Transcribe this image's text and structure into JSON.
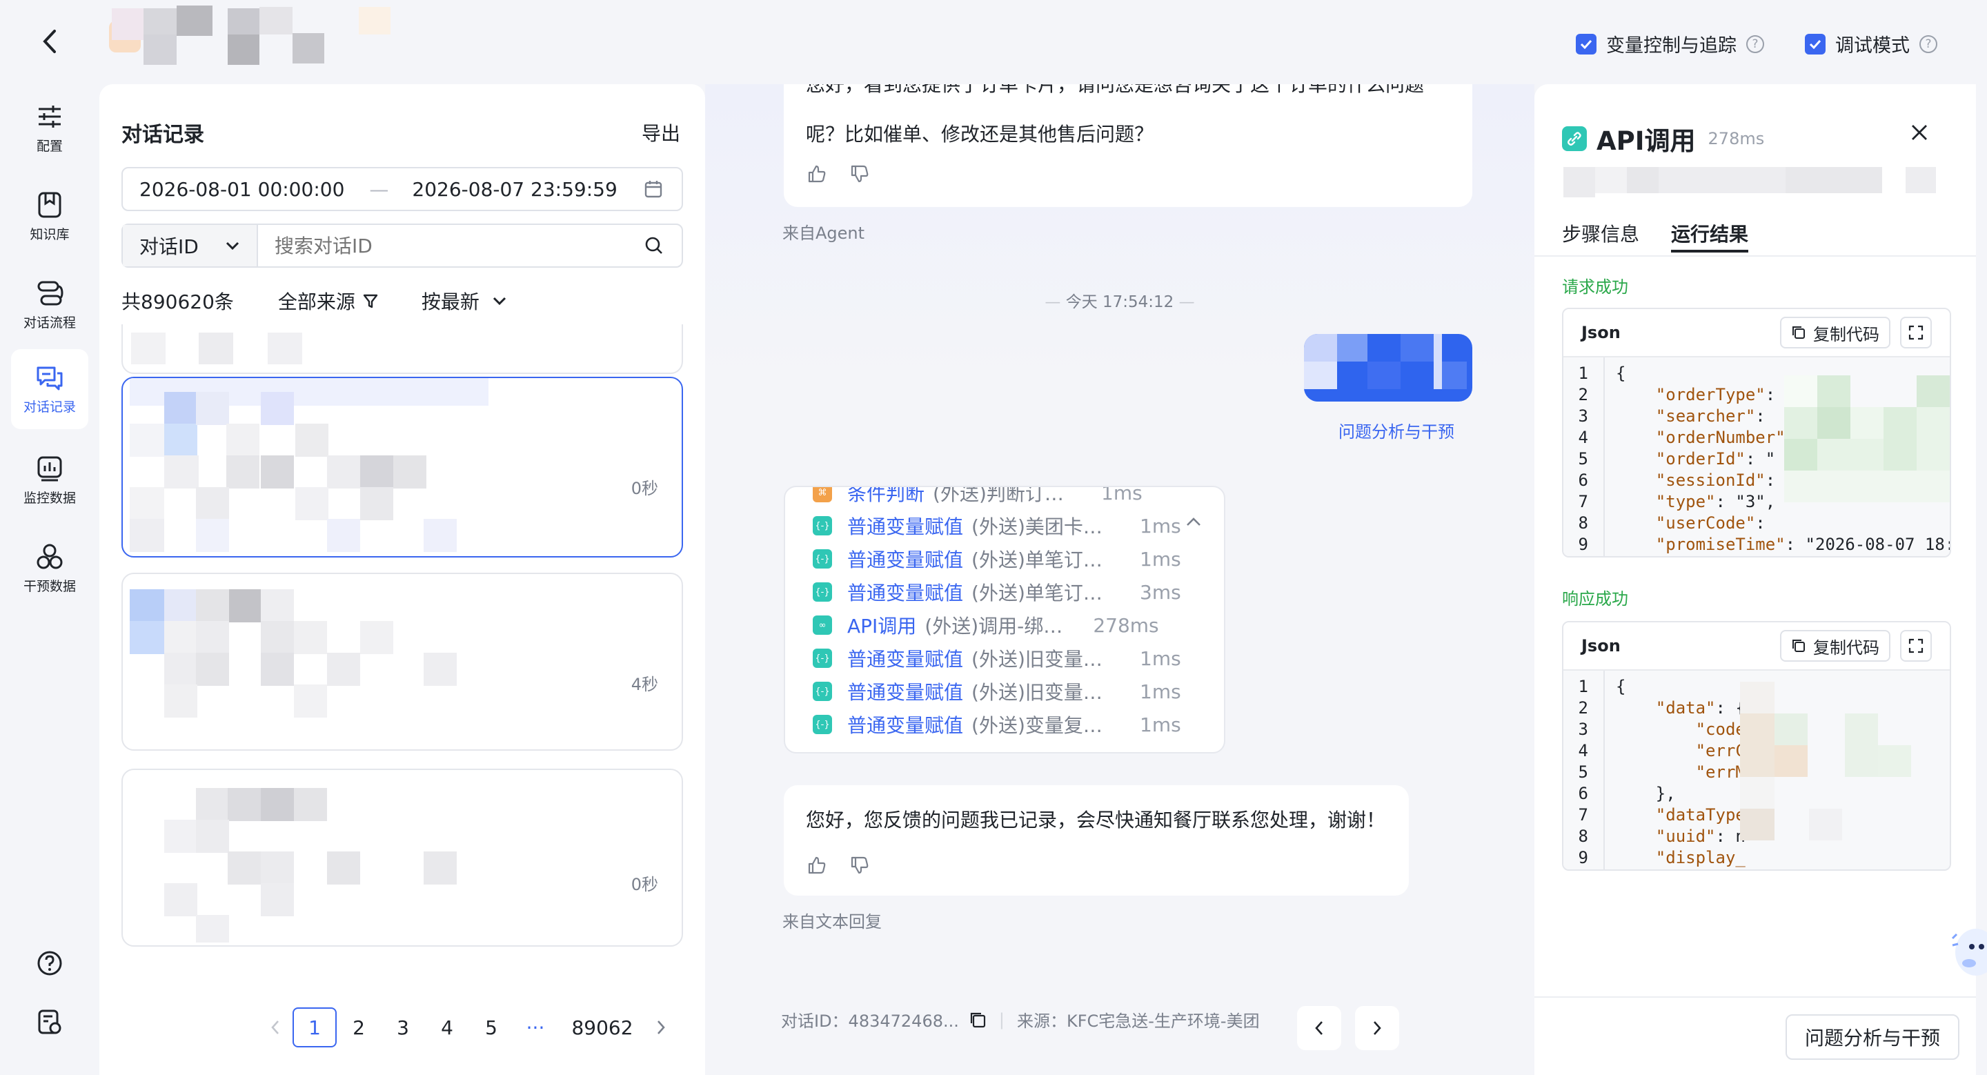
{
  "topbar": {
    "var_control_label": "变量控制与追踪",
    "debug_mode_label": "调试模式"
  },
  "sidebar": {
    "items": [
      {
        "label": "配置",
        "icon": "sliders-icon"
      },
      {
        "label": "知识库",
        "icon": "bookmark-icon"
      },
      {
        "label": "对话流程",
        "icon": "flow-icon"
      },
      {
        "label": "对话记录",
        "icon": "chat-icon"
      },
      {
        "label": "监控数据",
        "icon": "chart-icon"
      },
      {
        "label": "干预数据",
        "icon": "shapes-icon"
      }
    ]
  },
  "conversation_panel": {
    "title": "对话记录",
    "export_label": "导出",
    "date_start": "2026-08-01 00:00:00",
    "date_end": "2026-08-07 23:59:59",
    "date_separator": "—",
    "search_type": "对话ID",
    "search_placeholder": "搜索对话ID",
    "total_label": "共890620条",
    "source_filter": "全部来源",
    "sort_label": "按最新",
    "cards": [
      {
        "duration": "0秒"
      },
      {
        "duration": "4秒"
      },
      {
        "duration": "0秒"
      }
    ],
    "pagination": {
      "pages": [
        "1",
        "2",
        "3",
        "4",
        "5"
      ],
      "ellipsis": "···",
      "last": "89062",
      "current": "1"
    }
  },
  "chat": {
    "msg1_partial_line": "您好，看到您提供了订单卡片，请问您是想咨询关于这个订单的什么问题",
    "msg1_text": "呢？比如催单、修改还是其他售后问题？",
    "msg1_source": "来自Agent",
    "timestamp": "今天 17:54:12",
    "user_action_link": "问题分析与干预",
    "steps": [
      {
        "name": "条件判断",
        "desc": "(外送)判断订单卡片...",
        "ms": "1ms",
        "kind": "condition"
      },
      {
        "name": "普通变量赋值",
        "desc": "(外送)美团卡片...",
        "ms": "1ms",
        "kind": "var"
      },
      {
        "name": "普通变量赋值",
        "desc": "(外送)单笔订单...",
        "ms": "1ms",
        "kind": "var"
      },
      {
        "name": "普通变量赋值",
        "desc": "(外送)单笔订单...",
        "ms": "3ms",
        "kind": "var"
      },
      {
        "name": "API调用",
        "desc": "(外送)调用-绑定订...",
        "ms": "278ms",
        "kind": "api"
      },
      {
        "name": "普通变量赋值",
        "desc": "(外送)旧变量赋...",
        "ms": "1ms",
        "kind": "var"
      },
      {
        "name": "普通变量赋值",
        "desc": "(外送)旧变量赋...",
        "ms": "1ms",
        "kind": "var"
      },
      {
        "name": "普通变量赋值",
        "desc": "(外送)变量复制...",
        "ms": "1ms",
        "kind": "var"
      }
    ],
    "msg2_text": "您好，您反馈的问题我已记录，会尽快通知餐厅联系您处理，谢谢！",
    "msg2_source": "来自文本回复",
    "footer_conv_id": "对话ID：483472468...",
    "footer_source": "来源：KFC宅急送-生产环境-美团"
  },
  "right_panel": {
    "title": "API调用",
    "duration": "278ms",
    "tabs": [
      "步骤信息",
      "运行结果"
    ],
    "active_tab": "运行结果",
    "request_status": "请求成功",
    "response_status": "响应成功",
    "code_lang": "Json",
    "copy_label": "复制代码",
    "request_code": [
      {
        "n": "1",
        "t": "{"
      },
      {
        "n": "2",
        "k": "\"orderType\"",
        "r": ": \"1\","
      },
      {
        "n": "3",
        "k": "\"searcher\"",
        "r": ":"
      },
      {
        "n": "4",
        "k": "\"orderNumber\"",
        "r": ""
      },
      {
        "n": "5",
        "k": "\"orderId\"",
        "r": ": \""
      },
      {
        "n": "6",
        "k": "\"sessionId\"",
        "r": ":"
      },
      {
        "n": "7",
        "k": "\"type\"",
        "r": ": \"3\","
      },
      {
        "n": "8",
        "k": "\"userCode\"",
        "r": ":"
      },
      {
        "n": "9",
        "k": "\"promiseTime\"",
        "r": ": \"2026-08-07 18:"
      }
    ],
    "response_code": [
      {
        "n": "1",
        "t": "{"
      },
      {
        "n": "2",
        "k": "\"data\"",
        "r": ": {"
      },
      {
        "n": "3",
        "k": "    \"code",
        "r": ""
      },
      {
        "n": "4",
        "k": "    \"errC",
        "r": ""
      },
      {
        "n": "5",
        "k": "    \"errM",
        "r": ""
      },
      {
        "n": "6",
        "t": "    },"
      },
      {
        "n": "7",
        "k": "\"dataType",
        "r": ""
      },
      {
        "n": "8",
        "k": "\"uuid\"",
        "r": ": n"
      },
      {
        "n": "9",
        "k": "\"display_",
        "r": ""
      }
    ],
    "bottom_button": "问题分析与干预"
  }
}
